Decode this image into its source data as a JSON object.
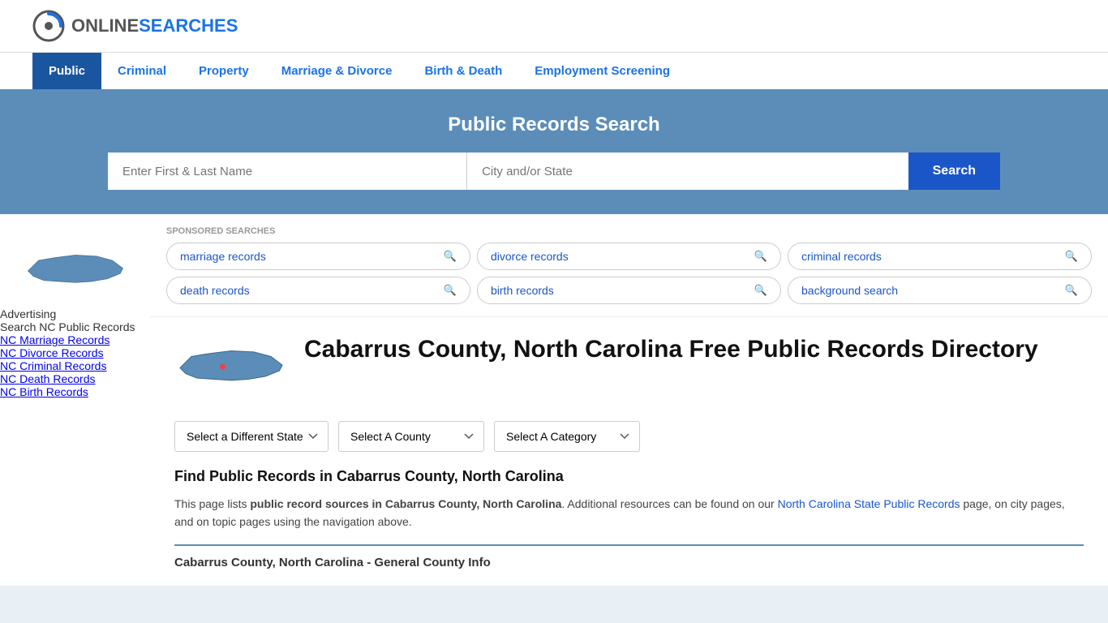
{
  "logo": {
    "text_online": "ONLINE",
    "text_searches": "SEARCHES",
    "icon_alt": "OnlineSearches Logo"
  },
  "nav": {
    "items": [
      {
        "label": "Public",
        "active": true
      },
      {
        "label": "Criminal",
        "active": false
      },
      {
        "label": "Property",
        "active": false
      },
      {
        "label": "Marriage & Divorce",
        "active": false
      },
      {
        "label": "Birth & Death",
        "active": false
      },
      {
        "label": "Employment Screening",
        "active": false
      }
    ]
  },
  "hero": {
    "title": "Public Records Search",
    "name_placeholder": "Enter First & Last Name",
    "location_placeholder": "City and/or State",
    "search_button": "Search"
  },
  "sponsored": {
    "label": "SPONSORED SEARCHES",
    "items": [
      "marriage records",
      "divorce records",
      "criminal records",
      "death records",
      "birth records",
      "background search"
    ]
  },
  "directory": {
    "title": "Cabarrus County, North Carolina Free Public Records Directory",
    "state_dropdown": "Select a Different State",
    "county_dropdown": "Select A County",
    "category_dropdown": "Select A Category",
    "find_title": "Find Public Records in Cabarrus County, North Carolina",
    "find_text_1": "This page lists ",
    "find_bold": "public record sources in Cabarrus County, North Carolina",
    "find_text_2": ". Additional resources can be found on our ",
    "find_link_text": "North Carolina State Public Records",
    "find_text_3": " page, on city pages, and on topic pages using the navigation above.",
    "county_info_header": "Cabarrus County, North Carolina - General County Info"
  },
  "sidebar": {
    "advertising_label": "Advertising",
    "ad_box_text": "Search NC Public Records",
    "links": [
      {
        "label": "NC Marriage Records",
        "url": "#"
      },
      {
        "label": "NC Divorce Records",
        "url": "#"
      },
      {
        "label": "NC Criminal Records",
        "url": "#"
      },
      {
        "label": "NC Death Records",
        "url": "#"
      },
      {
        "label": "NC Birth Records",
        "url": "#"
      }
    ]
  }
}
